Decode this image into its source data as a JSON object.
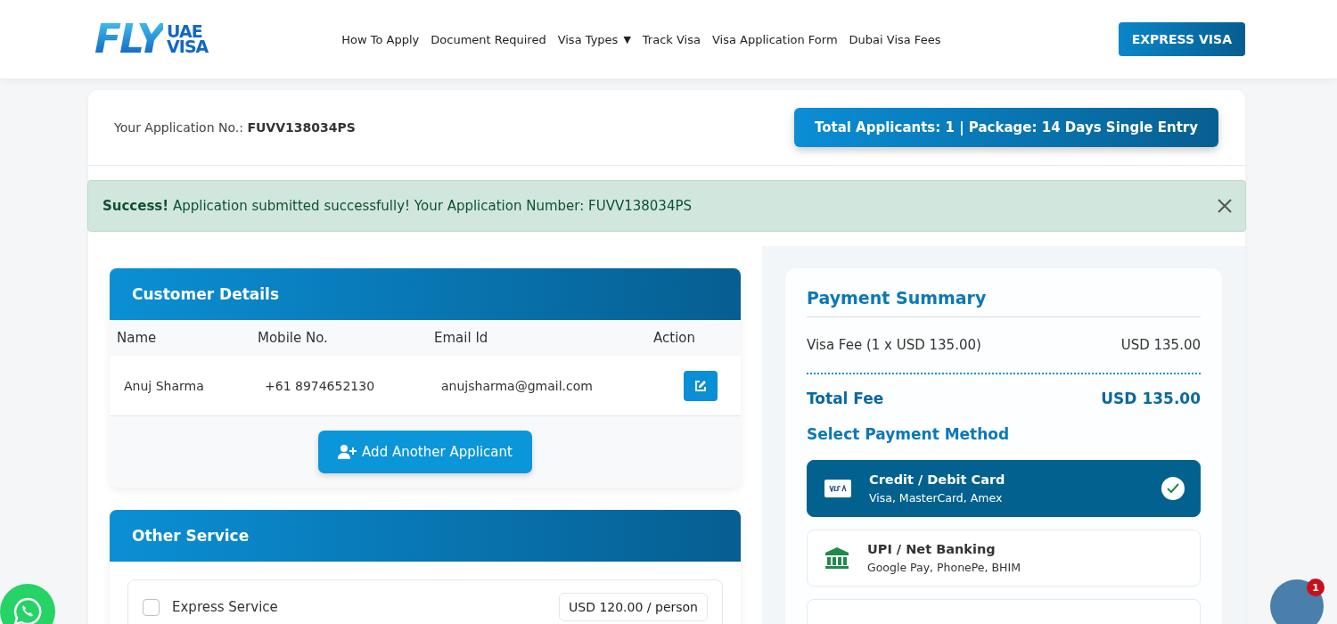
{
  "header": {
    "logo": {
      "big": "FLY",
      "top": "UAE",
      "bottom": "VISA"
    },
    "nav": [
      {
        "label": "How To Apply",
        "dropdown": false
      },
      {
        "label": "Document Required",
        "dropdown": false
      },
      {
        "label": "Visa Types",
        "dropdown": true,
        "caret": "▼"
      },
      {
        "label": "Track Visa",
        "dropdown": false
      },
      {
        "label": "Visa Application Form",
        "dropdown": false
      },
      {
        "label": "Dubai Visa Fees",
        "dropdown": false
      }
    ],
    "cta": "EXPRESS VISA"
  },
  "application": {
    "label": "Your Application No.:",
    "number": "FUVV138034PS",
    "summary": "Total Applicants: 1 | Package: 14 Days Single Entry"
  },
  "alert": {
    "text": "**Success!** Application submitted successfully! Your Application Number: FUVV138034PS"
  },
  "customer_details": {
    "title": "Customer Details",
    "columns": [
      "Name",
      "Mobile No.",
      "Email Id",
      "Action"
    ],
    "rows": [
      {
        "name": "Anuj Sharma",
        "mobile": "+61 8974652130",
        "email": "anujsharma@gmail.com"
      }
    ],
    "add_button": "Add Another Applicant"
  },
  "other_service": {
    "title": "Other Service",
    "items": [
      {
        "label": "Express Service",
        "price": "USD 120.00 / person",
        "checked": false
      }
    ]
  },
  "payment_summary": {
    "title": "Payment Summary",
    "lines": [
      {
        "label": "Visa Fee (1 x USD 135.00)",
        "amount": "USD 135.00"
      }
    ],
    "total": {
      "label": "Total Fee",
      "amount": "USD 135.00"
    },
    "method_title": "Select Payment Method",
    "methods": [
      {
        "kind": "card",
        "title": "Credit / Debit Card",
        "subtitle": "Visa, MasterCard, Amex",
        "selected": true
      },
      {
        "kind": "bank",
        "title": "UPI / Net Banking",
        "subtitle": "Google Pay, PhonePe, BHIM",
        "selected": false
      },
      {
        "kind": "other",
        "selected": false
      }
    ]
  },
  "chat": {
    "badge": "1"
  }
}
